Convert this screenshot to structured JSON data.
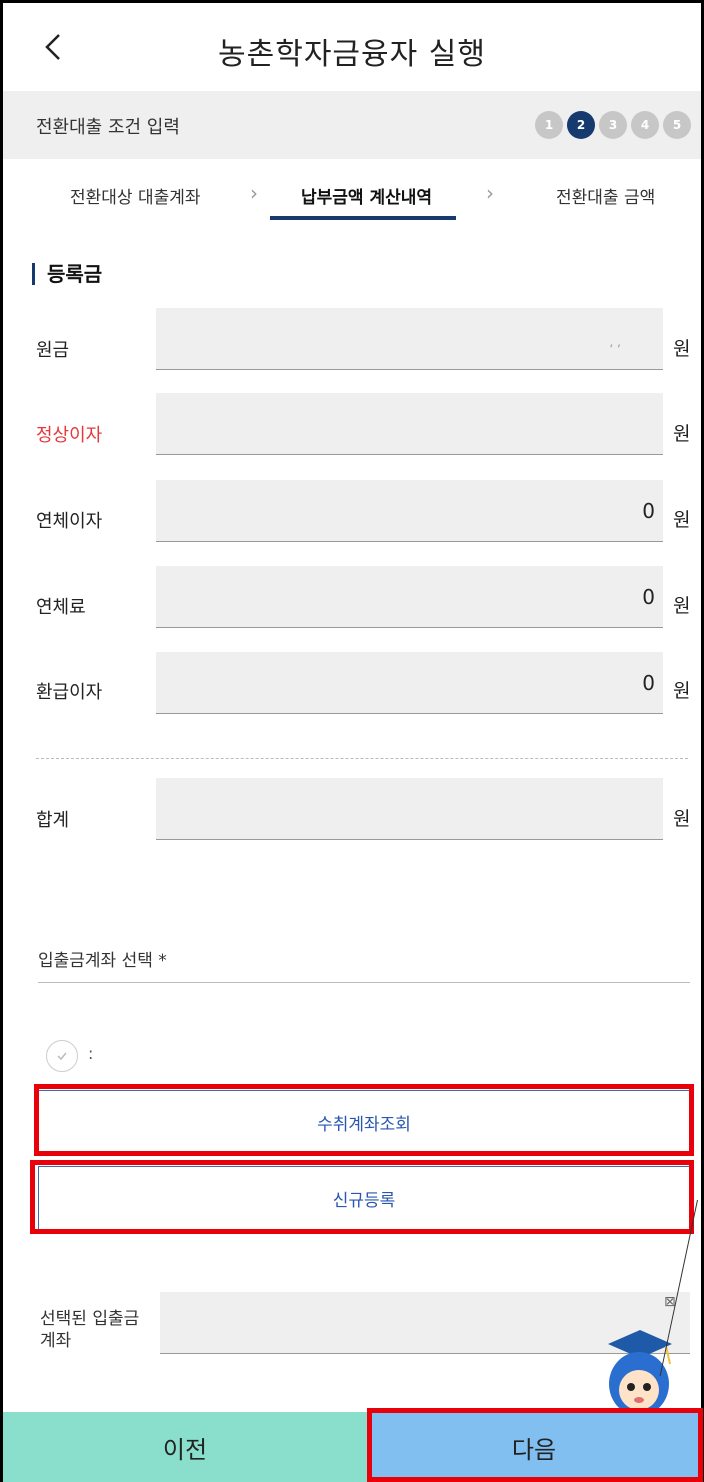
{
  "header": {
    "title": "농촌학자금융자 실행"
  },
  "stepbar": {
    "title": "전환대출 조건 입력",
    "steps": [
      "1",
      "2",
      "3",
      "4",
      "5"
    ],
    "active_step": 2
  },
  "tabs": [
    {
      "label": "전환대상 대출계좌"
    },
    {
      "label": "납부금액 계산내역"
    },
    {
      "label": "전환대출 금액"
    }
  ],
  "section": {
    "title": "등록금"
  },
  "rows": [
    {
      "label": "원금",
      "value": ", ,",
      "unit": "원"
    },
    {
      "label": "정상이자",
      "value": "",
      "unit": "원"
    },
    {
      "label": "연체이자",
      "value": "0",
      "unit": "원"
    },
    {
      "label": "연체료",
      "value": "0",
      "unit": "원"
    },
    {
      "label": "환급이자",
      "value": "0",
      "unit": "원"
    }
  ],
  "total": {
    "label": "합계",
    "value": "",
    "unit": "원"
  },
  "account": {
    "label": "입출금계좌 선택 *",
    "radio_text": ":"
  },
  "buttons": {
    "lookup": "수취계좌조회",
    "register": "신규등록",
    "prev": "이전",
    "next": "다음"
  },
  "selected": {
    "label": "선택된 입출금계좌",
    "close": "⊠"
  },
  "colors": {
    "accent": "#173a6e",
    "highlight": "#e8000b",
    "prev_bg": "#8adfcc",
    "next_bg": "#80bff0",
    "red_label": "#e63838"
  }
}
